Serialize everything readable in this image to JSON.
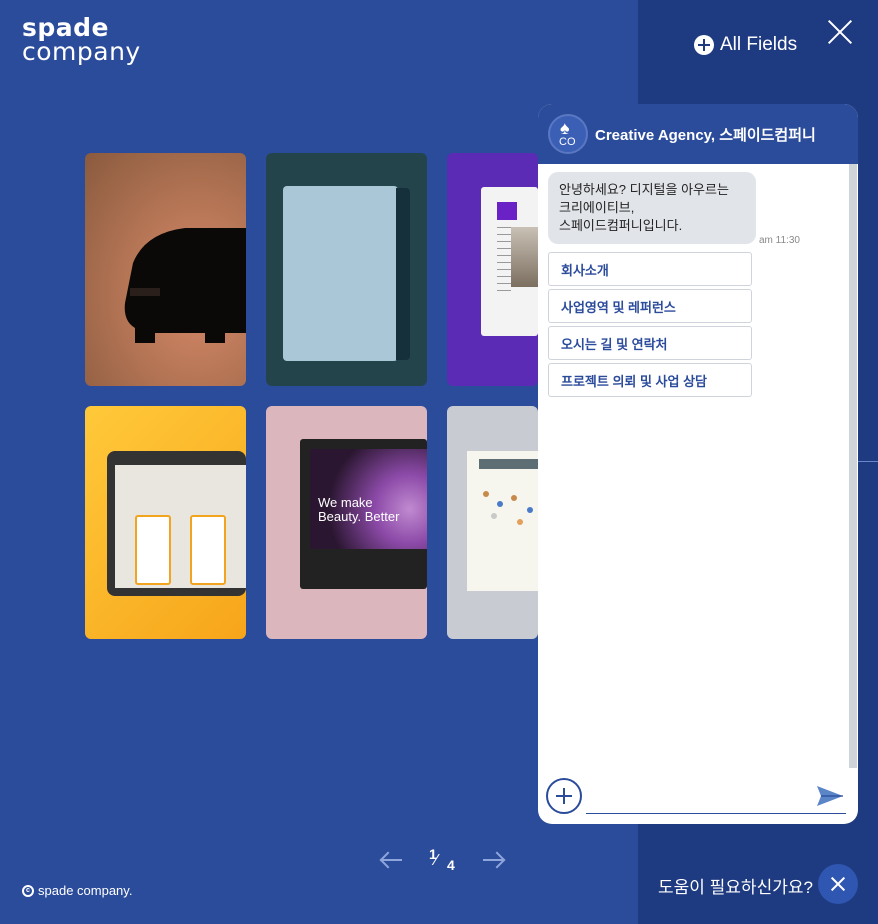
{
  "brand": {
    "line1": "spade",
    "line2": "company"
  },
  "header": {
    "all_fields": "All Fields"
  },
  "pager": {
    "current": "1",
    "total": "4"
  },
  "footer": {
    "copyright": "spade company.",
    "help": "도움이 필요하신가요?"
  },
  "cards": {
    "c5_text_line1": "We make",
    "c5_text_line2": "Beauty. Better"
  },
  "chat": {
    "title": "Creative Agency, 스페이드컴퍼니",
    "avatar_text": "CO",
    "message_line1": "안녕하세요? 디지털을 아우르는",
    "message_line2": "크리에이티브,",
    "message_line3": "스페이드컴퍼니입니다.",
    "time": "am 11:30",
    "quick_replies": [
      "회사소개",
      "사업영역 및 레퍼런스",
      "오시는 길 및 연락처",
      "프로젝트 의뢰 및 사업 상담"
    ],
    "input_value": ""
  },
  "colors": {
    "accent": "#2b4b9b",
    "sidebar": "#1e3a80"
  }
}
